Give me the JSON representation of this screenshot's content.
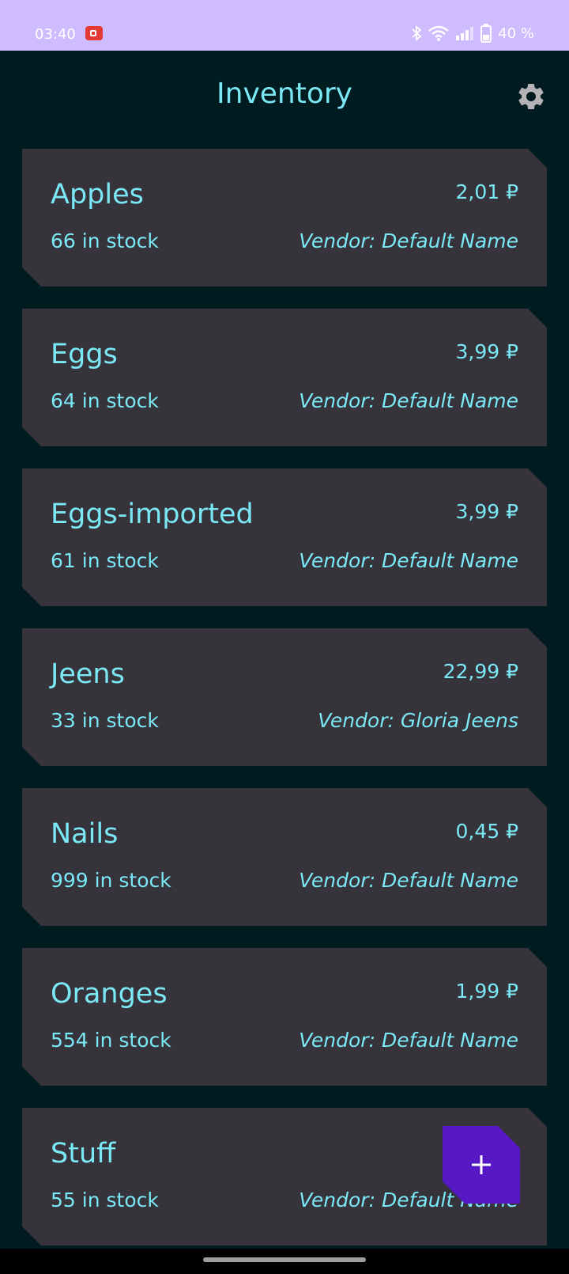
{
  "status_bar": {
    "time": "03:40",
    "battery_text": "40 %"
  },
  "app_bar": {
    "title": "Inventory",
    "settings_icon": "gear-icon"
  },
  "items": [
    {
      "name": "Apples",
      "price": "2,01 ₽",
      "stock": "66 in stock",
      "vendor": "Vendor: Default Name"
    },
    {
      "name": "Eggs",
      "price": "3,99 ₽",
      "stock": "64 in stock",
      "vendor": "Vendor: Default Name"
    },
    {
      "name": "Eggs-imported",
      "price": "3,99 ₽",
      "stock": "61 in stock",
      "vendor": "Vendor: Default Name"
    },
    {
      "name": "Jeens",
      "price": "22,99 ₽",
      "stock": "33 in stock",
      "vendor": "Vendor: Gloria Jeens"
    },
    {
      "name": "Nails",
      "price": "0,45 ₽",
      "stock": "999 in stock",
      "vendor": "Vendor: Default Name"
    },
    {
      "name": "Oranges",
      "price": "1,99 ₽",
      "stock": "554 in stock",
      "vendor": "Vendor: Default Name"
    },
    {
      "name": "Stuff",
      "price": "",
      "stock": "55 in stock",
      "vendor": "Vendor: Default Name"
    }
  ],
  "fab": {
    "icon": "plus-icon"
  },
  "colors": {
    "background": "#001c20",
    "card": "#36333b",
    "text_accent": "#7ae8f5",
    "status_bar": "#cfbcff",
    "fab": "#5518c4"
  }
}
